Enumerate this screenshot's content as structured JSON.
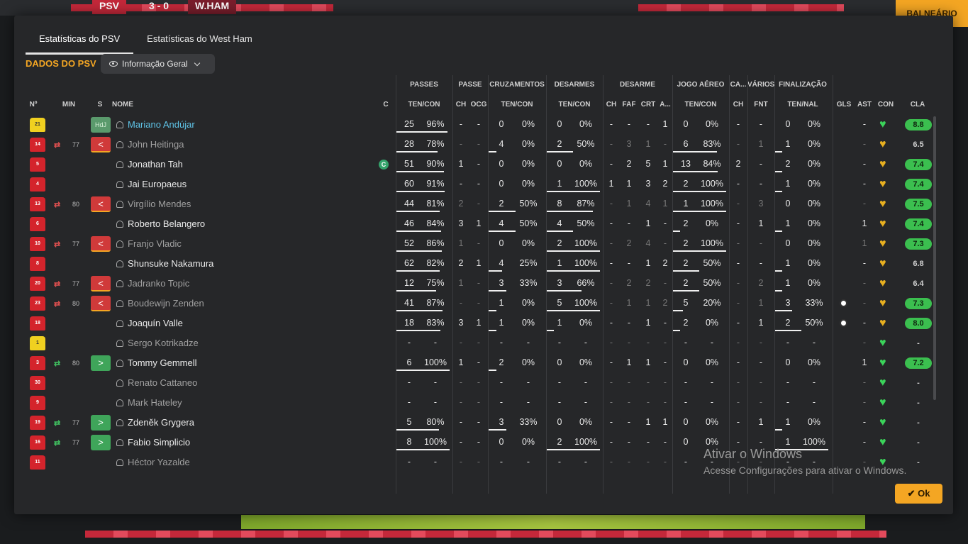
{
  "header": {
    "home": "PSV",
    "score": "3 - 0",
    "away": "W.HAM",
    "balneario": "BALNEÁRIO"
  },
  "tabs": [
    "Estatísticas do PSV",
    "Estatísticas do West Ham"
  ],
  "section_title": "DADOS DO PSV",
  "dropdown": {
    "label": "Informação Geral"
  },
  "group_headers": [
    "PASSES",
    "PASSE",
    "CRUZAMENTOS",
    "DESARMES",
    "DESARME",
    "JOGO AÉREO",
    "CA...",
    "VÁRIOS",
    "FINALIZAÇÃO"
  ],
  "column_headers": {
    "no": "Nº",
    "min": "MIN",
    "s": "S",
    "nome": "NOME",
    "c": "C",
    "passes": "TEN/CON",
    "passe_ch": "CH",
    "passe_ocg": "OCG",
    "cruz": "TEN/CON",
    "desarmes": "TEN/CON",
    "des_ch": "CH",
    "des_faf": "FAF",
    "des_crt": "CRT",
    "des_a": "A...",
    "aereo": "TEN/CON",
    "ca_ch": "CH",
    "varios_fnt": "FNT",
    "final": "TEN/NAL",
    "gls": "GLS",
    "ast": "AST",
    "con": "CON",
    "cla": "CLA"
  },
  "players": [
    {
      "no": "21",
      "kit": "yellow",
      "sub": "",
      "min": "",
      "status": "HdJ",
      "name": "Mariano Andújar",
      "cap": false,
      "dim": false,
      "accent": true,
      "passes": [
        "25",
        "96%"
      ],
      "pb": 0.96,
      "p_ch": "-",
      "p_ocg": "-",
      "cruz": [
        "0",
        "0%"
      ],
      "cb": 0,
      "des": [
        "0",
        "0%"
      ],
      "db": 0,
      "d_ch": "-",
      "d_faf": "-",
      "d_crt": "-",
      "d_a": "1",
      "aer": [
        "0",
        "0%"
      ],
      "ab": 0,
      "ca_ch": "-",
      "fnt": "-",
      "fin": [
        "0",
        "0%"
      ],
      "fb": 0,
      "gls": "",
      "ast": "-",
      "con": "green",
      "cla": "8.8",
      "cla_green": true
    },
    {
      "no": "14",
      "kit": "red",
      "sub": "out",
      "min": "77",
      "status": "out",
      "name": "John Heitinga",
      "cap": false,
      "dim": true,
      "passes": [
        "28",
        "78%"
      ],
      "pb": 0.78,
      "p_ch": "-",
      "p_ocg": "-",
      "cruz": [
        "4",
        "0%"
      ],
      "cb": 0,
      "des": [
        "2",
        "50%"
      ],
      "db": 0.5,
      "d_ch": "-",
      "d_faf": "3",
      "d_crt": "1",
      "d_a": "-",
      "aer": [
        "6",
        "83%"
      ],
      "ab": 0.83,
      "ca_ch": "-",
      "fnt": "1",
      "fin": [
        "1",
        "0%"
      ],
      "fb": 0,
      "gls": "",
      "ast": "-",
      "con": "yellow",
      "cla": "6.5",
      "cla_green": false
    },
    {
      "no": "5",
      "kit": "red",
      "sub": "",
      "min": "",
      "status": "",
      "name": "Jonathan Tah",
      "cap": true,
      "dim": false,
      "passes": [
        "51",
        "90%"
      ],
      "pb": 0.9,
      "p_ch": "1",
      "p_ocg": "-",
      "cruz": [
        "0",
        "0%"
      ],
      "cb": 0,
      "des": [
        "0",
        "0%"
      ],
      "db": 0,
      "d_ch": "-",
      "d_faf": "2",
      "d_crt": "5",
      "d_a": "1",
      "aer": [
        "13",
        "84%"
      ],
      "ab": 0.84,
      "ca_ch": "2",
      "fnt": "-",
      "fin": [
        "2",
        "0%"
      ],
      "fb": 0,
      "gls": "",
      "ast": "-",
      "con": "yellow",
      "cla": "7.4",
      "cla_green": true
    },
    {
      "no": "4",
      "kit": "red",
      "sub": "",
      "min": "",
      "status": "",
      "name": "Jai Europaeus",
      "cap": false,
      "dim": false,
      "passes": [
        "60",
        "91%"
      ],
      "pb": 0.91,
      "p_ch": "-",
      "p_ocg": "-",
      "cruz": [
        "0",
        "0%"
      ],
      "cb": 0,
      "des": [
        "1",
        "100%"
      ],
      "db": 1,
      "d_ch": "1",
      "d_faf": "1",
      "d_crt": "3",
      "d_a": "2",
      "aer": [
        "2",
        "100%"
      ],
      "ab": 1,
      "ca_ch": "-",
      "fnt": "-",
      "fin": [
        "1",
        "0%"
      ],
      "fb": 0,
      "gls": "",
      "ast": "-",
      "con": "yellow",
      "cla": "7.4",
      "cla_green": true
    },
    {
      "no": "13",
      "kit": "red",
      "sub": "out",
      "min": "80",
      "status": "out",
      "name": "Virgílio Mendes",
      "cap": false,
      "dim": true,
      "passes": [
        "44",
        "81%"
      ],
      "pb": 0.81,
      "p_ch": "2",
      "p_ocg": "-",
      "cruz": [
        "2",
        "50%"
      ],
      "cb": 0.5,
      "des": [
        "8",
        "87%"
      ],
      "db": 0.87,
      "d_ch": "-",
      "d_faf": "1",
      "d_crt": "4",
      "d_a": "1",
      "aer": [
        "1",
        "100%"
      ],
      "ab": 1,
      "ca_ch": "-",
      "fnt": "3",
      "fin": [
        "0",
        "0%"
      ],
      "fb": 0,
      "gls": "",
      "ast": "-",
      "con": "yellow",
      "cla": "7.5",
      "cla_green": true
    },
    {
      "no": "6",
      "kit": "red",
      "sub": "",
      "min": "",
      "status": "",
      "name": "Roberto Belangero",
      "cap": false,
      "dim": false,
      "passes": [
        "46",
        "84%"
      ],
      "pb": 0.84,
      "p_ch": "3",
      "p_ocg": "1",
      "cruz": [
        "4",
        "50%"
      ],
      "cb": 0.5,
      "des": [
        "4",
        "50%"
      ],
      "db": 0.5,
      "d_ch": "-",
      "d_faf": "-",
      "d_crt": "1",
      "d_a": "-",
      "aer": [
        "2",
        "0%"
      ],
      "ab": 0,
      "ca_ch": "-",
      "fnt": "1",
      "fin": [
        "1",
        "0%"
      ],
      "fb": 0,
      "gls": "",
      "ast": "1",
      "con": "yellow",
      "cla": "7.4",
      "cla_green": true
    },
    {
      "no": "10",
      "kit": "red",
      "sub": "out",
      "min": "77",
      "status": "out",
      "name": "Franjo Vladic",
      "cap": false,
      "dim": true,
      "passes": [
        "52",
        "86%"
      ],
      "pb": 0.86,
      "p_ch": "1",
      "p_ocg": "-",
      "cruz": [
        "0",
        "0%"
      ],
      "cb": 0,
      "des": [
        "2",
        "100%"
      ],
      "db": 1,
      "d_ch": "-",
      "d_faf": "2",
      "d_crt": "4",
      "d_a": "-",
      "aer": [
        "2",
        "100%"
      ],
      "ab": 1,
      "ca_ch": "-",
      "fnt": "-",
      "fin": [
        "0",
        "0%"
      ],
      "fb": 0,
      "gls": "",
      "ast": "1",
      "con": "yellow",
      "cla": "7.3",
      "cla_green": true
    },
    {
      "no": "8",
      "kit": "red",
      "sub": "",
      "min": "",
      "status": "",
      "name": "Shunsuke Nakamura",
      "cap": false,
      "dim": false,
      "passes": [
        "62",
        "82%"
      ],
      "pb": 0.82,
      "p_ch": "2",
      "p_ocg": "1",
      "cruz": [
        "4",
        "25%"
      ],
      "cb": 0.25,
      "des": [
        "1",
        "100%"
      ],
      "db": 1,
      "d_ch": "-",
      "d_faf": "-",
      "d_crt": "1",
      "d_a": "2",
      "aer": [
        "2",
        "50%"
      ],
      "ab": 0.5,
      "ca_ch": "-",
      "fnt": "-",
      "fin": [
        "1",
        "0%"
      ],
      "fb": 0,
      "gls": "",
      "ast": "-",
      "con": "yellow",
      "cla": "6.8",
      "cla_green": false
    },
    {
      "no": "20",
      "kit": "red",
      "sub": "out",
      "min": "77",
      "status": "out",
      "name": "Jadranko Topic",
      "cap": false,
      "dim": true,
      "passes": [
        "12",
        "75%"
      ],
      "pb": 0.75,
      "p_ch": "1",
      "p_ocg": "-",
      "cruz": [
        "3",
        "33%"
      ],
      "cb": 0.33,
      "des": [
        "3",
        "66%"
      ],
      "db": 0.66,
      "d_ch": "-",
      "d_faf": "2",
      "d_crt": "2",
      "d_a": "-",
      "aer": [
        "2",
        "50%"
      ],
      "ab": 0.5,
      "ca_ch": "-",
      "fnt": "2",
      "fin": [
        "1",
        "0%"
      ],
      "fb": 0,
      "gls": "",
      "ast": "-",
      "con": "yellow",
      "cla": "6.4",
      "cla_green": false
    },
    {
      "no": "23",
      "kit": "red",
      "sub": "out",
      "min": "80",
      "status": "out",
      "name": "Boudewijn Zenden",
      "cap": false,
      "dim": true,
      "passes": [
        "41",
        "87%"
      ],
      "pb": 0.87,
      "p_ch": "-",
      "p_ocg": "-",
      "cruz": [
        "1",
        "0%"
      ],
      "cb": 0,
      "des": [
        "5",
        "100%"
      ],
      "db": 1,
      "d_ch": "-",
      "d_faf": "1",
      "d_crt": "1",
      "d_a": "2",
      "aer": [
        "5",
        "20%"
      ],
      "ab": 0.2,
      "ca_ch": "-",
      "fnt": "1",
      "fin": [
        "3",
        "33%"
      ],
      "fb": 0.33,
      "gls": "ball",
      "ast": "-",
      "con": "yellow",
      "cla": "7.3",
      "cla_green": true
    },
    {
      "no": "18",
      "kit": "red",
      "sub": "",
      "min": "",
      "status": "",
      "name": "Joaquín Valle",
      "cap": false,
      "dim": false,
      "passes": [
        "18",
        "83%"
      ],
      "pb": 0.83,
      "p_ch": "3",
      "p_ocg": "1",
      "cruz": [
        "1",
        "0%"
      ],
      "cb": 0,
      "des": [
        "1",
        "0%"
      ],
      "db": 0,
      "d_ch": "-",
      "d_faf": "-",
      "d_crt": "1",
      "d_a": "-",
      "aer": [
        "2",
        "0%"
      ],
      "ab": 0,
      "ca_ch": "-",
      "fnt": "1",
      "fin": [
        "2",
        "50%"
      ],
      "fb": 0.5,
      "gls": "ball",
      "ast": "-",
      "con": "yellow",
      "cla": "8.0",
      "cla_green": true
    },
    {
      "no": "1",
      "kit": "yellow",
      "sub": "",
      "min": "",
      "status": "",
      "name": "Sergo Kotrikadze",
      "cap": false,
      "dim": true,
      "passes": [
        "-",
        "-"
      ],
      "pb": 0,
      "p_ch": "-",
      "p_ocg": "-",
      "cruz": [
        "-",
        "-"
      ],
      "cb": 0,
      "des": [
        "-",
        "-"
      ],
      "db": 0,
      "d_ch": "-",
      "d_faf": "-",
      "d_crt": "-",
      "d_a": "-",
      "aer": [
        "-",
        "-"
      ],
      "ab": 0,
      "ca_ch": "-",
      "fnt": "-",
      "fin": [
        "-",
        "-"
      ],
      "fb": 0,
      "gls": "",
      "ast": "-",
      "con": "green",
      "cla": "-",
      "cla_green": false
    },
    {
      "no": "3",
      "kit": "red",
      "sub": "in",
      "min": "80",
      "status": "in",
      "name": "Tommy Gemmell",
      "cap": false,
      "dim": false,
      "passes": [
        "6",
        "100%"
      ],
      "pb": 1,
      "p_ch": "1",
      "p_ocg": "-",
      "cruz": [
        "2",
        "0%"
      ],
      "cb": 0,
      "des": [
        "0",
        "0%"
      ],
      "db": 0,
      "d_ch": "-",
      "d_faf": "1",
      "d_crt": "1",
      "d_a": "-",
      "aer": [
        "0",
        "0%"
      ],
      "ab": 0,
      "ca_ch": "-",
      "fnt": "-",
      "fin": [
        "0",
        "0%"
      ],
      "fb": 0,
      "gls": "",
      "ast": "1",
      "con": "green",
      "cla": "7.2",
      "cla_green": true
    },
    {
      "no": "30",
      "kit": "red",
      "sub": "",
      "min": "",
      "status": "",
      "name": "Renato Cattaneo",
      "cap": false,
      "dim": true,
      "passes": [
        "-",
        "-"
      ],
      "pb": 0,
      "p_ch": "-",
      "p_ocg": "-",
      "cruz": [
        "-",
        "-"
      ],
      "cb": 0,
      "des": [
        "-",
        "-"
      ],
      "db": 0,
      "d_ch": "-",
      "d_faf": "-",
      "d_crt": "-",
      "d_a": "-",
      "aer": [
        "-",
        "-"
      ],
      "ab": 0,
      "ca_ch": "-",
      "fnt": "-",
      "fin": [
        "-",
        "-"
      ],
      "fb": 0,
      "gls": "",
      "ast": "-",
      "con": "green",
      "cla": "-",
      "cla_green": false
    },
    {
      "no": "9",
      "kit": "red",
      "sub": "",
      "min": "",
      "status": "",
      "name": "Mark Hateley",
      "cap": false,
      "dim": true,
      "passes": [
        "-",
        "-"
      ],
      "pb": 0,
      "p_ch": "-",
      "p_ocg": "-",
      "cruz": [
        "-",
        "-"
      ],
      "cb": 0,
      "des": [
        "-",
        "-"
      ],
      "db": 0,
      "d_ch": "-",
      "d_faf": "-",
      "d_crt": "-",
      "d_a": "-",
      "aer": [
        "-",
        "-"
      ],
      "ab": 0,
      "ca_ch": "-",
      "fnt": "-",
      "fin": [
        "-",
        "-"
      ],
      "fb": 0,
      "gls": "",
      "ast": "-",
      "con": "green",
      "cla": "-",
      "cla_green": false
    },
    {
      "no": "19",
      "kit": "red",
      "sub": "in",
      "min": "77",
      "status": "in",
      "name": "Zdeněk Grygera",
      "cap": false,
      "dim": false,
      "passes": [
        "5",
        "80%"
      ],
      "pb": 0.8,
      "p_ch": "-",
      "p_ocg": "-",
      "cruz": [
        "3",
        "33%"
      ],
      "cb": 0.33,
      "des": [
        "0",
        "0%"
      ],
      "db": 0,
      "d_ch": "-",
      "d_faf": "-",
      "d_crt": "1",
      "d_a": "1",
      "aer": [
        "0",
        "0%"
      ],
      "ab": 0,
      "ca_ch": "-",
      "fnt": "1",
      "fin": [
        "1",
        "0%"
      ],
      "fb": 0,
      "gls": "",
      "ast": "-",
      "con": "green",
      "cla": "-",
      "cla_green": false
    },
    {
      "no": "16",
      "kit": "red",
      "sub": "in",
      "min": "77",
      "status": "in",
      "name": "Fabio Simplicio",
      "cap": false,
      "dim": false,
      "passes": [
        "8",
        "100%"
      ],
      "pb": 1,
      "p_ch": "-",
      "p_ocg": "-",
      "cruz": [
        "0",
        "0%"
      ],
      "cb": 0,
      "des": [
        "2",
        "100%"
      ],
      "db": 1,
      "d_ch": "-",
      "d_faf": "-",
      "d_crt": "-",
      "d_a": "-",
      "aer": [
        "0",
        "0%"
      ],
      "ab": 0,
      "ca_ch": "-",
      "fnt": "-",
      "fin": [
        "1",
        "100%"
      ],
      "fb": 1,
      "gls": "",
      "ast": "-",
      "con": "green",
      "cla": "-",
      "cla_green": false
    },
    {
      "no": "11",
      "kit": "red",
      "sub": "",
      "min": "",
      "status": "",
      "name": "Héctor Yazalde",
      "cap": false,
      "dim": true,
      "passes": [
        "-",
        "-"
      ],
      "pb": 0,
      "p_ch": "-",
      "p_ocg": "-",
      "cruz": [
        "-",
        "-"
      ],
      "cb": 0,
      "des": [
        "-",
        "-"
      ],
      "db": 0,
      "d_ch": "-",
      "d_faf": "-",
      "d_crt": "-",
      "d_a": "-",
      "aer": [
        "-",
        "-"
      ],
      "ab": 0,
      "ca_ch": "-",
      "fnt": "-",
      "fin": [
        "-",
        "-"
      ],
      "fb": 0,
      "gls": "",
      "ast": "-",
      "con": "green",
      "cla": "-",
      "cla_green": false
    }
  ],
  "status_labels": {
    "hdj": "HdJ",
    "out": "<",
    "in": ">"
  },
  "captain_label": "C",
  "ok_button": "Ok",
  "watermark": {
    "line1": "Ativar o Windows",
    "line2": "Acesse Configurações para ativar o Windows."
  }
}
